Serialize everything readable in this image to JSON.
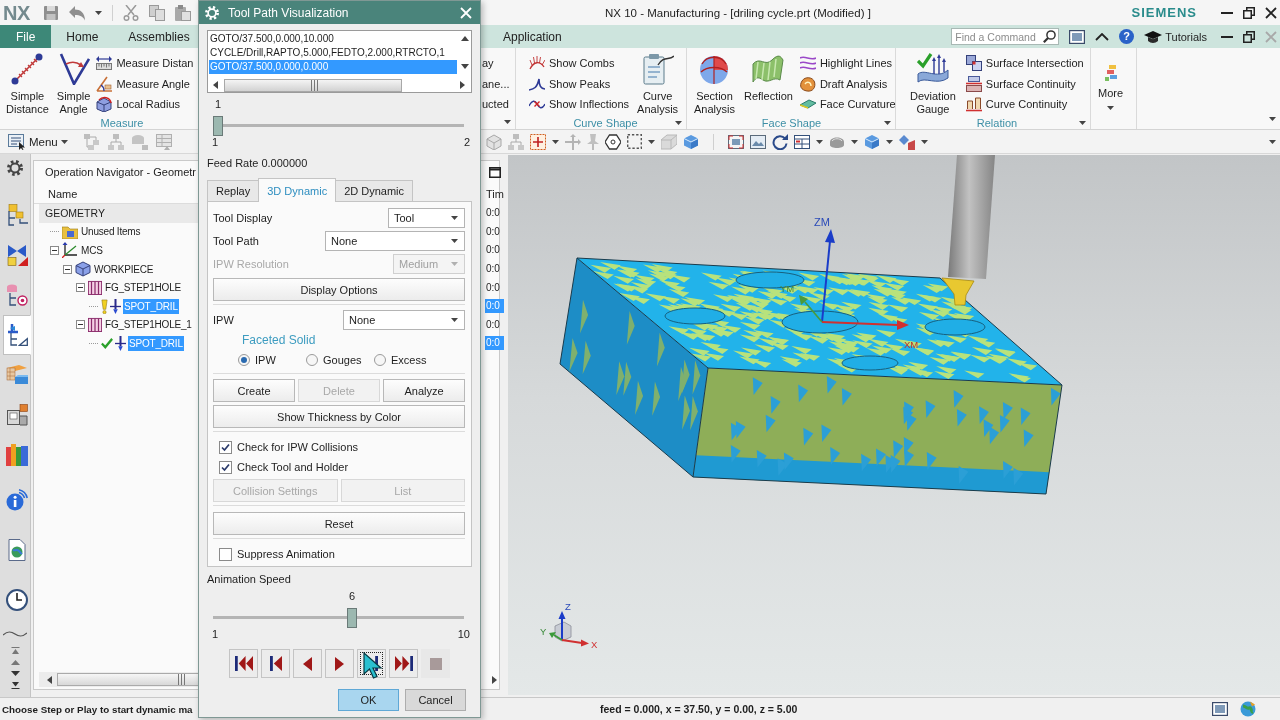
{
  "app_window": {
    "logo": "NX",
    "title": "NX 10 - Manufacturing - [driling cycle.prt (Modified) ]",
    "brand": "SIEMENS"
  },
  "ribbon_tabs": [
    {
      "label": "File",
      "kind": "file",
      "selected": false
    },
    {
      "label": "Home",
      "kind": "tab",
      "selected": false
    },
    {
      "label": "Assemblies",
      "kind": "tab",
      "selected": false
    },
    {
      "label": "Application",
      "kind": "tab",
      "selected": false
    }
  ],
  "command_finder": {
    "placeholder": "Find a Command"
  },
  "help_bar": {
    "help": "?",
    "tutorials": "Tutorials"
  },
  "ribbon_groups": [
    {
      "label": "Measure",
      "items": [
        {
          "kind": "large",
          "label": "Simple Distance"
        },
        {
          "kind": "large",
          "label": "Simple Angle"
        },
        {
          "kind": "stack",
          "items": [
            "Measure Distan",
            "Measure Angle",
            "Local Radius"
          ]
        }
      ]
    },
    {
      "menu": true,
      "items": [
        {
          "kind": "stack",
          "items": [
            "ay",
            "ane...",
            "ucted"
          ]
        }
      ]
    },
    {
      "label": "Curve Shape",
      "menu": true,
      "items": [
        {
          "kind": "stack",
          "items": [
            "Show Combs",
            "Show Peaks",
            "Show Inflections"
          ]
        },
        {
          "kind": "large",
          "label": "Curve Analysis"
        }
      ]
    },
    {
      "label": "Face Shape",
      "menu": true,
      "items": [
        {
          "kind": "large",
          "label": "Section Analysis"
        },
        {
          "kind": "large",
          "label": "Reflection"
        },
        {
          "kind": "stack",
          "items": [
            "Highlight Lines",
            "Draft Analysis",
            "Face Curvature"
          ]
        }
      ]
    },
    {
      "label": "Relation",
      "menu": true,
      "items": [
        {
          "kind": "large",
          "label": "Deviation Gauge"
        },
        {
          "kind": "stack",
          "items": [
            "Surface Intersection",
            "Surface Continuity",
            "Curve Continuity"
          ]
        }
      ]
    },
    {
      "menu": false,
      "items": [
        {
          "kind": "more",
          "label": "More"
        }
      ]
    }
  ],
  "toolbar": {
    "menu": "Menu"
  },
  "resource_tabs": [
    {
      "selected": false
    },
    {
      "selected": false
    },
    {
      "selected": false
    },
    {
      "selected": true
    },
    {
      "selected": false
    },
    {
      "selected": false
    },
    {
      "selected": false
    },
    {
      "selected": false
    },
    {
      "selected": false
    },
    {
      "selected": false
    }
  ],
  "navigator": {
    "title": "Operation Navigator - Geometr",
    "columns": [
      "Name",
      "Tim"
    ],
    "tree": [
      {
        "label": "GEOMETRY",
        "kind": "root",
        "time": "0:0",
        "selected": false,
        "children": [
          {
            "label": "Unused Items",
            "kind": "folder",
            "time": "0:0",
            "selected": false
          },
          {
            "label": "MCS",
            "kind": "mcs",
            "time": "0:0",
            "selected": false,
            "expanded": true,
            "children": [
              {
                "label": "WORKPIECE",
                "kind": "workpiece",
                "time": "0:0",
                "selected": false,
                "expanded": true,
                "children": [
                  {
                    "label": "FG_STEP1HOLE",
                    "kind": "feature_group",
                    "time": "0:0",
                    "selected": false,
                    "expanded": true,
                    "children": [
                      {
                        "label": "SPOT_DRIL",
                        "kind": "operation",
                        "complete": false,
                        "time": "0:0",
                        "selected": true
                      }
                    ]
                  },
                  {
                    "label": "FG_STEP1HOLE_1",
                    "kind": "feature_group",
                    "time": "0:0",
                    "selected": false,
                    "expanded": true,
                    "children": [
                      {
                        "label": "SPOT_DRIL",
                        "kind": "operation",
                        "complete": true,
                        "time": "0:0",
                        "selected": true
                      }
                    ]
                  }
                ]
              }
            ]
          }
        ]
      }
    ]
  },
  "dialog": {
    "title": "Tool Path Visualization",
    "path_list": [
      {
        "text": "GOTO/37.500,0.000,10.000",
        "selected": false
      },
      {
        "text": "CYCLE/Drill,RAPTO,5.000,FEDTO,2.000,RTRCTO,1",
        "selected": false
      },
      {
        "text": "GOTO/37.500,0.000,0.000",
        "selected": true
      }
    ],
    "step_slider": {
      "value": "1",
      "min": "1",
      "max": "2",
      "level": 0
    },
    "feed_rate": "Feed Rate 0.000000",
    "tabs": [
      {
        "label": "Replay",
        "selected": false
      },
      {
        "label": "3D Dynamic",
        "selected": true
      },
      {
        "label": "2D Dynamic",
        "selected": false
      }
    ],
    "settings": [
      {
        "kind": "dropdown",
        "label": "Tool Display",
        "value": "Tool",
        "disabled": false
      },
      {
        "kind": "dropdown",
        "label": "Tool Path",
        "value": "None",
        "disabled": false
      },
      {
        "kind": "dropdown",
        "label": "IPW Resolution",
        "value": "Medium",
        "disabled": true
      },
      {
        "kind": "button",
        "label": "Display Options",
        "disabled": false
      },
      {
        "kind": "dropdown",
        "label": "IPW",
        "value": "None",
        "disabled": false
      },
      {
        "kind": "heading",
        "label": "Faceted Solid"
      },
      {
        "kind": "radios",
        "options": [
          {
            "label": "IPW",
            "selected": true
          },
          {
            "label": "Gouges",
            "selected": false
          },
          {
            "label": "Excess",
            "selected": false
          }
        ]
      },
      {
        "kind": "buttons",
        "buttons": [
          {
            "label": "Create",
            "disabled": false
          },
          {
            "label": "Delete",
            "disabled": true
          },
          {
            "label": "Analyze",
            "disabled": false
          }
        ]
      },
      {
        "kind": "button",
        "label": "Show Thickness by Color",
        "disabled": false
      },
      {
        "kind": "checkbox",
        "label": "Check for IPW Collisions",
        "checked": true
      },
      {
        "kind": "checkbox",
        "label": "Check Tool and Holder",
        "checked": true
      },
      {
        "kind": "buttons",
        "buttons": [
          {
            "label": "Collision Settings",
            "disabled": true
          },
          {
            "label": "List",
            "disabled": true
          }
        ]
      },
      {
        "kind": "button",
        "label": "Reset",
        "disabled": false
      },
      {
        "kind": "checkbox",
        "label": "Suppress Animation",
        "checked": false
      }
    ],
    "animation_speed": {
      "label": "Animation Speed",
      "value": "6",
      "min": "1",
      "max": "10",
      "level": 0.556
    },
    "playback": [
      {
        "kind": "to_start",
        "disabled": false,
        "focused": false
      },
      {
        "kind": "step_back",
        "disabled": false,
        "focused": false
      },
      {
        "kind": "play_reverse",
        "disabled": false,
        "focused": false
      },
      {
        "kind": "play",
        "disabled": false,
        "focused": false
      },
      {
        "kind": "step_forward",
        "disabled": false,
        "focused": true
      },
      {
        "kind": "to_end",
        "disabled": false,
        "focused": false
      },
      {
        "kind": "stop",
        "disabled": true,
        "focused": false
      }
    ],
    "buttons": [
      {
        "label": "OK",
        "default": true
      },
      {
        "label": "Cancel",
        "default": false
      }
    ]
  },
  "viewport": {
    "axes": {
      "z": "ZM",
      "x": "XM",
      "y": "YM"
    },
    "triad": {
      "z": "Z",
      "y": "Y",
      "x": "X"
    }
  },
  "status_bar": {
    "prompt": "Choose Step or Play to start dynamic ma",
    "readout": "feed = 0.000, x = 37.50, y = 0.00, z = 5.00"
  }
}
